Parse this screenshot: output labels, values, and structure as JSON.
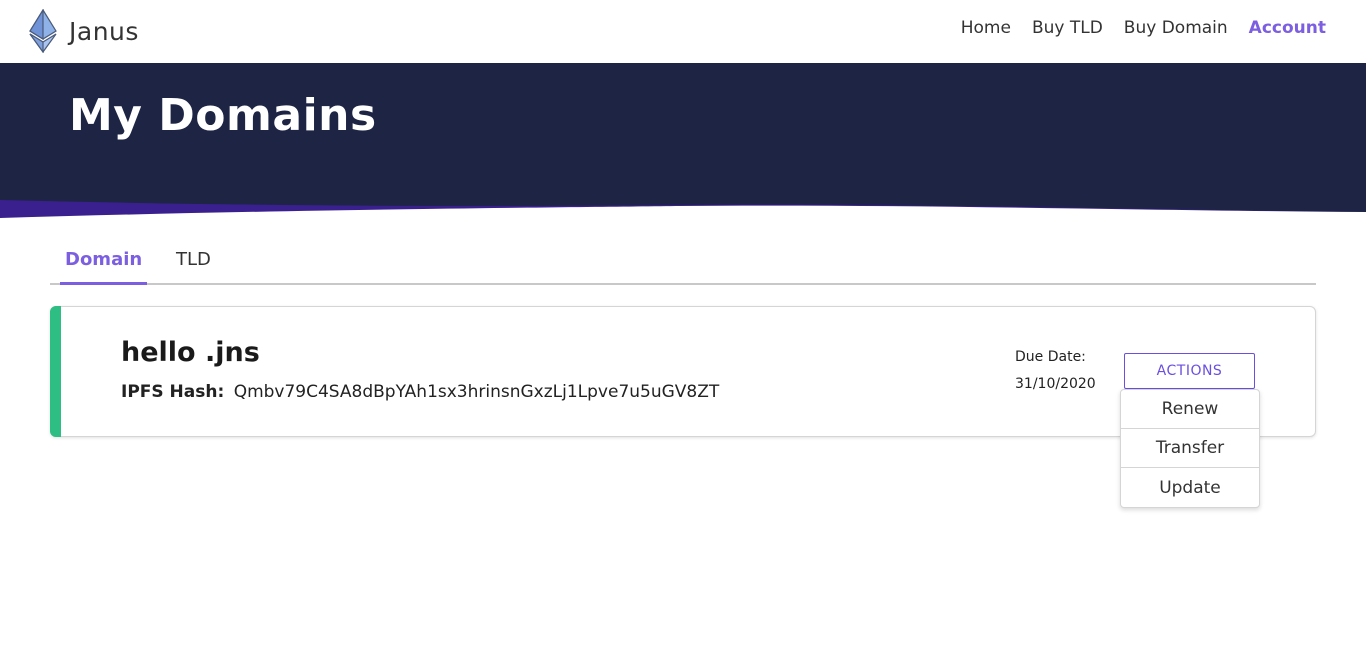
{
  "brand": {
    "name": "Janus",
    "logo_icon": "ethereum-diamond-icon"
  },
  "nav": {
    "links": [
      {
        "label": "Home"
      },
      {
        "label": "Buy TLD"
      },
      {
        "label": "Buy Domain"
      },
      {
        "label": "Account"
      }
    ]
  },
  "hero": {
    "title": "My Domains"
  },
  "tabs": [
    {
      "label": "Domain"
    },
    {
      "label": "TLD"
    }
  ],
  "domains": [
    {
      "name": "hello .jns",
      "hash_label": "IPFS Hash:",
      "hash_value": "Qmbv79C4SA8dBpYAh1sx3hrinsnGxzLj1Lpve7u5uGV8ZT",
      "due_label": "Due Date:",
      "due_value": "31/10/2020",
      "actions_label": "ACTIONS",
      "status_color": "#2ebd83"
    }
  ],
  "actions_menu": {
    "items": [
      {
        "label": "Renew"
      },
      {
        "label": "Transfer"
      },
      {
        "label": "Update"
      }
    ]
  },
  "colors": {
    "accent": "#7b5fe0",
    "hero_bg": "#1d2444",
    "wave": "#3a1f8f"
  }
}
